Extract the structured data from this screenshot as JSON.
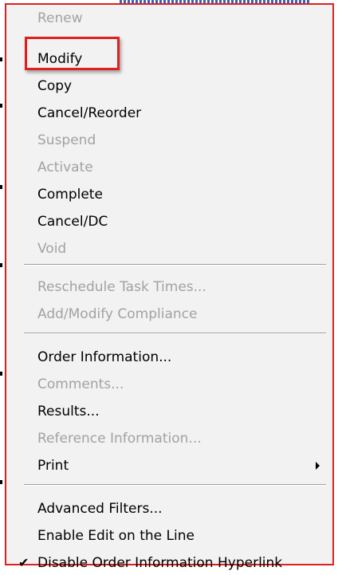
{
  "colors": {
    "menu_background": "#f2f2f2",
    "enabled_text": "#000000",
    "disabled_text": "#a2a2a2",
    "annotation_red": "#e02020"
  },
  "menu": {
    "groups": [
      {
        "items": [
          {
            "label": "Renew",
            "enabled": false
          },
          {
            "label": "Modify",
            "enabled": true,
            "highlighted": true
          },
          {
            "label": "Copy",
            "enabled": true
          },
          {
            "label": "Cancel/Reorder",
            "enabled": true
          },
          {
            "label": "Suspend",
            "enabled": false
          },
          {
            "label": "Activate",
            "enabled": false
          },
          {
            "label": "Complete",
            "enabled": true
          },
          {
            "label": "Cancel/DC",
            "enabled": true
          },
          {
            "label": "Void",
            "enabled": false
          }
        ]
      },
      {
        "items": [
          {
            "label": "Reschedule Task Times...",
            "enabled": false
          },
          {
            "label": "Add/Modify Compliance",
            "enabled": false
          }
        ]
      },
      {
        "items": [
          {
            "label": "Order Information...",
            "enabled": true
          },
          {
            "label": "Comments...",
            "enabled": false
          },
          {
            "label": "Results...",
            "enabled": true
          },
          {
            "label": "Reference Information...",
            "enabled": false
          },
          {
            "label": "Print",
            "enabled": true,
            "submenu": true,
            "submenu_icon": "chevron-right-icon"
          }
        ]
      },
      {
        "items": [
          {
            "label": "Advanced Filters...",
            "enabled": true
          },
          {
            "label": "Enable Edit on the Line",
            "enabled": true
          },
          {
            "label": "Disable Order Information Hyperlink",
            "enabled": true,
            "checked": true,
            "check_icon": "checkmark-icon"
          }
        ]
      }
    ]
  }
}
